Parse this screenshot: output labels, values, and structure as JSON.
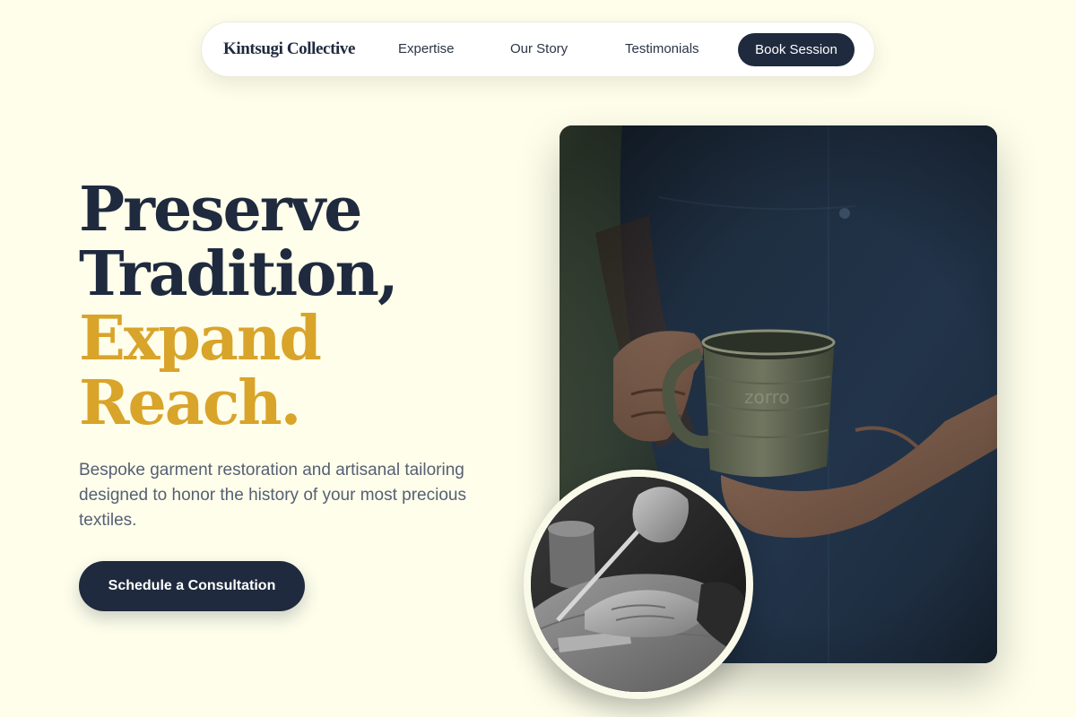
{
  "nav": {
    "brand": "Kintsugi Collective",
    "links": [
      {
        "label": "Expertise"
      },
      {
        "label": "Our Story"
      },
      {
        "label": "Testimonials"
      }
    ],
    "cta_label": "Book Session"
  },
  "hero": {
    "headline_lines": [
      {
        "text": "Preserve",
        "color": "dark"
      },
      {
        "text": "Tradition,",
        "color": "dark"
      },
      {
        "text": "Expand",
        "color": "gold"
      },
      {
        "text": "Reach.",
        "color": "gold"
      }
    ],
    "subtitle": "Bespoke garment restoration and artisanal tailoring designed to honor the history of your most precious textiles.",
    "cta_label": "Schedule a Consultation"
  },
  "images": {
    "main": {
      "subject": "artisan in dark apron holding ceramic mug"
    },
    "circle": {
      "subject": "black and white hands carving wood with chisel"
    }
  },
  "colors": {
    "background": "#fefeeb",
    "navy": "#1f2a3e",
    "gold": "#d9a42a",
    "body_text": "#566073"
  }
}
